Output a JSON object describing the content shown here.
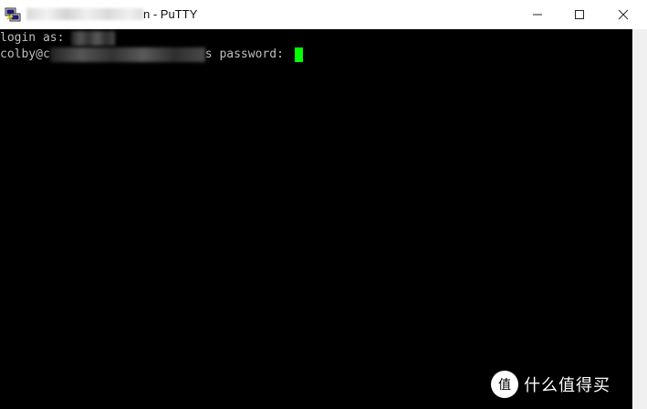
{
  "window": {
    "title": "n - PuTTY",
    "minimize_label": "",
    "maximize_label": "",
    "close_label": ""
  },
  "terminal": {
    "line1_prefix": "login as: ",
    "line2_prefix": "colby@c",
    "line2_suffix": "s password: ",
    "cursor_color": "#00ff00",
    "text_color": "#bfbfbf",
    "background": "#000000"
  },
  "watermark": {
    "text": "什么值得买",
    "logo_glyph": "值"
  },
  "icons": {
    "app": "putty-icon",
    "minimize": "minimize-icon",
    "maximize": "maximize-icon",
    "close": "close-icon"
  }
}
